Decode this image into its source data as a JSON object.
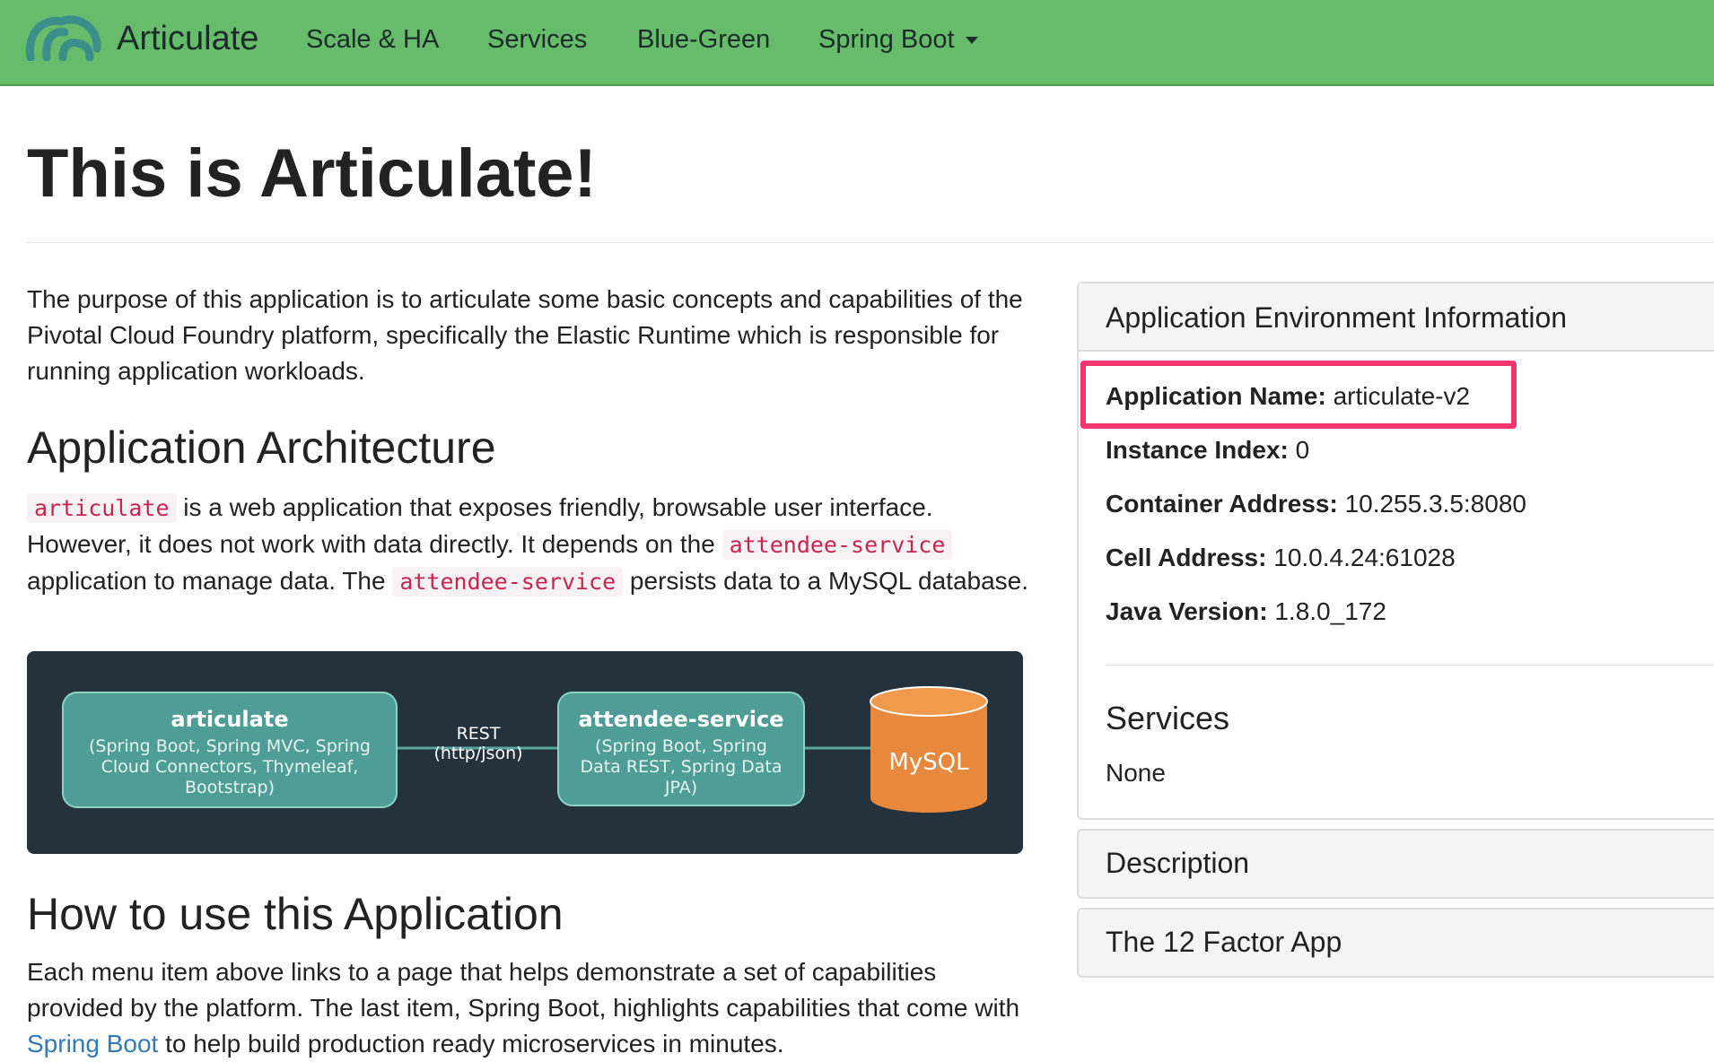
{
  "navbar": {
    "brand": "Articulate",
    "items": [
      {
        "label": "Scale & HA"
      },
      {
        "label": "Services"
      },
      {
        "label": "Blue-Green"
      },
      {
        "label": "Spring Boot",
        "dropdown": true
      }
    ],
    "colors": {
      "background": "#66bc6a",
      "logo": "#3b8f8a"
    }
  },
  "main": {
    "title": "This is Articulate!",
    "intro": "The purpose of this application is to articulate some basic concepts and capabilities of the Pivotal Cloud Foundry platform, specifically the Elastic Runtime which is responsible for running application workloads.",
    "architecture": {
      "heading": "Application Architecture",
      "code_articulate": "articulate",
      "text_1": " is a web application that exposes friendly, browsable user interface. However, it does not work with data directly. It depends on the ",
      "code_attendee_1": "attendee-service",
      "text_2": " application to manage data. The ",
      "code_attendee_2": "attendee-service",
      "text_3": " persists data to a MySQL database."
    },
    "diagram": {
      "box1_title": "articulate",
      "box1_desc": [
        "(Spring Boot, Spring MVC, Spring",
        "Cloud Connectors, Thymeleaf,",
        "Bootstrap)"
      ],
      "link_label": [
        "REST",
        "(http/json)"
      ],
      "box2_title": "attendee-service",
      "box2_desc": [
        "(Spring Boot, Spring",
        "Data REST, Spring Data",
        "JPA)"
      ],
      "db_label": "MySQL"
    },
    "howto": {
      "heading": "How to use this Application",
      "text_1": "Each menu item above links to a page that helps demonstrate a set of capabilities provided by the platform. The last item, Spring Boot, highlights capabilities that come with ",
      "link": "Spring Boot",
      "text_2": " to help build production ready microservices in minutes."
    }
  },
  "sidebar": {
    "env_panel": {
      "title": "Application Environment Information",
      "rows": [
        {
          "label": "Application Name:",
          "value": "articulate-v2"
        },
        {
          "label": "Instance Index:",
          "value": "0"
        },
        {
          "label": "Container Address:",
          "value": "10.255.3.5:8080"
        },
        {
          "label": "Cell Address:",
          "value": "10.0.4.24:61028"
        },
        {
          "label": "Java Version:",
          "value": "1.8.0_172"
        }
      ],
      "services_title": "Services",
      "services_value": "None"
    },
    "description_title": "Description",
    "twelve_factor_title": "The 12 Factor App",
    "highlight_color": "#f0356f"
  }
}
